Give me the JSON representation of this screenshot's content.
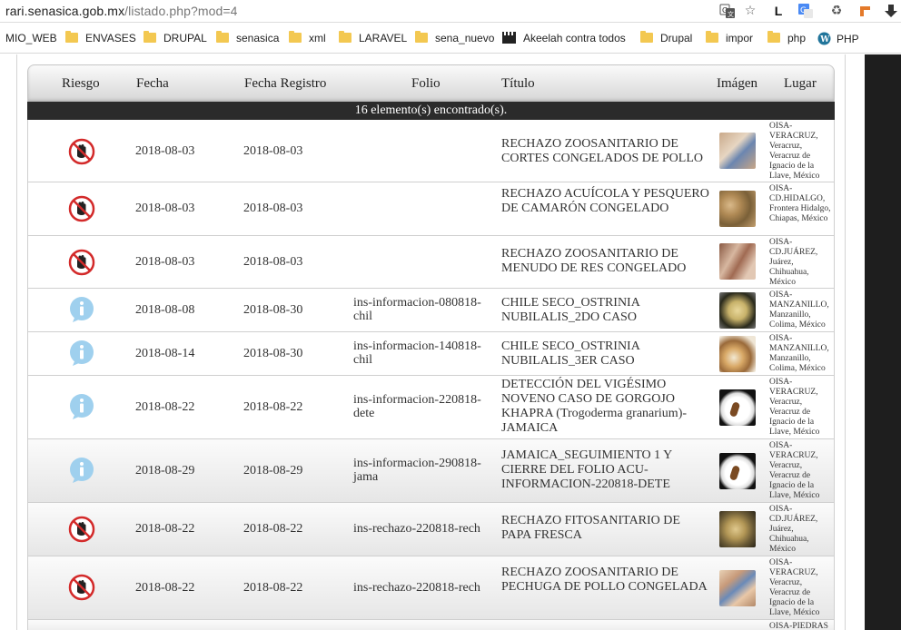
{
  "browser": {
    "url_host": "rari.senasica.gob.mx",
    "url_path": "/listado.php?mod=4",
    "toolbar_icons": [
      "translate-icon",
      "star-icon",
      "extension-l-icon",
      "google-translate-icon",
      "recycle-icon",
      "extension-orange-icon",
      "download-arrow-icon"
    ],
    "extension_letter": "L"
  },
  "bookmarks": [
    {
      "label": "MIO_WEB",
      "icon": "none"
    },
    {
      "label": "ENVASES",
      "icon": "folder"
    },
    {
      "label": "DRUPAL",
      "icon": "folder"
    },
    {
      "label": "senasica",
      "icon": "folder"
    },
    {
      "label": "xml",
      "icon": "folder"
    },
    {
      "label": "LARAVEL",
      "icon": "folder"
    },
    {
      "label": "sena_nuevo",
      "icon": "folder"
    },
    {
      "label": "Akeelah contra todos",
      "icon": "clapper"
    },
    {
      "label": "Drupal",
      "icon": "folder"
    },
    {
      "label": "impor",
      "icon": "folder"
    },
    {
      "label": "php",
      "icon": "folder"
    },
    {
      "label": "PHP",
      "icon": "wordpress"
    }
  ],
  "table": {
    "headers": {
      "riesgo": "Riesgo",
      "fecha": "Fecha",
      "fecha_registro": "Fecha Registro",
      "folio": "Folio",
      "titulo": "Título",
      "imagen": "Imágen",
      "lugar": "Lugar"
    },
    "count_text": "16 elemento(s) encontrado(s).",
    "rows": [
      {
        "risk": "rechazo",
        "fecha": "2018-08-03",
        "registro": "2018-08-03",
        "folio": "",
        "titulo": "RECHAZO ZOOSANITARIO DE CORTES CONGELADOS DE POLLO",
        "lugar": "OISA-VERACRUZ, Veracruz, Veracruz de Ignacio de la Llave, México",
        "thumb": "chicken-cuts",
        "style": "white"
      },
      {
        "risk": "rechazo",
        "fecha": "2018-08-03",
        "registro": "2018-08-03",
        "folio": "",
        "titulo": "RECHAZO ACUÍCOLA Y PESQUERO DE CAMARÓN CONGELADO",
        "lugar": "OISA-CD.HIDALGO, Frontera Hidalgo, Chiapas, México",
        "thumb": "shrimp",
        "style": "white"
      },
      {
        "risk": "rechazo",
        "fecha": "2018-08-03",
        "registro": "2018-08-03",
        "folio": "",
        "titulo": "RECHAZO ZOOSANITARIO DE MENUDO DE RES CONGELADO",
        "lugar": "OISA-CD.JUÁREZ, Juárez, Chihuahua, México",
        "thumb": "beef-tripe",
        "style": "white"
      },
      {
        "risk": "informacion",
        "fecha": "2018-08-08",
        "registro": "2018-08-30",
        "folio": "ins-informacion-080818-chil",
        "titulo": "CHILE SECO_OSTRINIA NUBILALIS_2DO CASO",
        "lugar": "OISA-MANZANILLO, Manzanillo, Colima, México",
        "thumb": "larva-1",
        "style": "white"
      },
      {
        "risk": "informacion",
        "fecha": "2018-08-14",
        "registro": "2018-08-30",
        "folio": "ins-informacion-140818-chil",
        "titulo": "CHILE SECO_OSTRINIA NUBILALIS_3ER CASO",
        "lugar": "OISA-MANZANILLO, Manzanillo, Colima, México",
        "thumb": "larva-2",
        "style": "white"
      },
      {
        "risk": "informacion",
        "fecha": "2018-08-22",
        "registro": "2018-08-22",
        "folio": "ins-informacion-220818-dete",
        "titulo": "DETECCIÓN DEL VIGÉSIMO NOVENO CASO DE GORGOJO KHAPRA (Trogoderma granarium)-JAMAICA",
        "lugar": "OISA-VERACRUZ, Veracruz, Veracruz de Ignacio de la Llave, México",
        "thumb": "beetle-larva",
        "style": "white"
      },
      {
        "risk": "informacion",
        "fecha": "2018-08-29",
        "registro": "2018-08-29",
        "folio": "ins-informacion-290818-jama",
        "titulo": "JAMAICA_SEGUIMIENTO 1 Y CIERRE DEL FOLIO ACU-INFORMACION-220818-DETE",
        "lugar": "OISA-VERACRUZ, Veracruz, Veracruz de Ignacio de la Llave, México",
        "thumb": "beetle-larva",
        "style": "grad"
      },
      {
        "risk": "rechazo",
        "fecha": "2018-08-22",
        "registro": "2018-08-22",
        "folio": "ins-rechazo-220818-rech",
        "titulo": "RECHAZO FITOSANITARIO DE PAPA FRESCA",
        "lugar": "OISA-CD.JUÁREZ, Juárez, Chihuahua, México",
        "thumb": "potato",
        "style": "grad"
      },
      {
        "risk": "rechazo",
        "fecha": "2018-08-22",
        "registro": "2018-08-22",
        "folio": "ins-rechazo-220818-rech",
        "titulo": "RECHAZO ZOOSANITARIO DE PECHUGA DE POLLO CONGELADA",
        "lugar": "OISA-VERACRUZ, Veracruz, Veracruz de Ignacio de la Llave, México",
        "thumb": "chicken-breast",
        "style": "grad"
      },
      {
        "risk": "",
        "fecha": "",
        "registro": "",
        "folio": "",
        "titulo": "",
        "lugar": "OISA-PIEDRAS",
        "thumb": "",
        "style": "grad"
      }
    ]
  },
  "colors": {
    "header_top": "#fafafa",
    "header_bottom": "#d6d6d6",
    "count_bar": "#2b2b2b",
    "info_icon": "#9fd0ee",
    "reject_icon": "#d32a2a"
  }
}
